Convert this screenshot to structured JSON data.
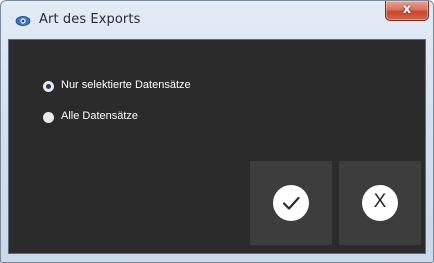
{
  "window": {
    "title": "Art des Exports",
    "close_glyph": "x",
    "icon": "eye-icon"
  },
  "options": {
    "selected_only": {
      "label": "Nur selektierte Datensätze",
      "selected": true
    },
    "all": {
      "label": "Alle Datensätze",
      "selected": false
    }
  },
  "buttons": {
    "confirm": {
      "icon": "checkmark-icon"
    },
    "cancel": {
      "icon": "x-icon",
      "glyph": "X"
    }
  },
  "colors": {
    "content_bg": "#2b2b2b",
    "button_bg": "#3d3d3d",
    "radio_dot": "#1f3f63",
    "text": "#ffffff"
  }
}
